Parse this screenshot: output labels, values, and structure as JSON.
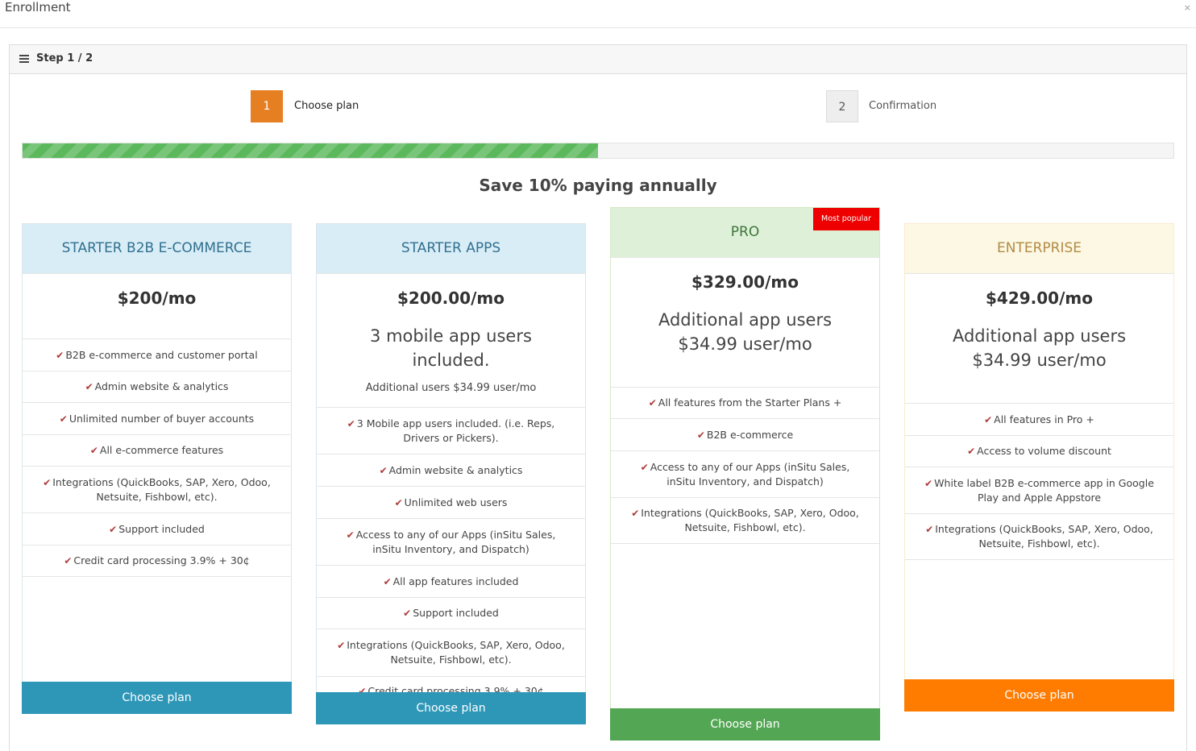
{
  "window": {
    "title": "Enrollment",
    "close": "×"
  },
  "panel": {
    "step_label": "Step 1 / 2"
  },
  "steps": [
    {
      "number": "1",
      "label": "Choose plan"
    },
    {
      "number": "2",
      "label": "Confirmation"
    }
  ],
  "progress": {
    "fraction": 0.5
  },
  "headline": "Save 10% paying annually",
  "colors": {
    "accent_orange": "#e67e22",
    "blue_button": "#2e97b8",
    "green_button": "#53a653",
    "orange_button": "#ff7c00",
    "badge_red": "#ee0000"
  },
  "plans": [
    {
      "name": "STARTER B2B E-COMMERCE",
      "price": "$200/mo",
      "features": [
        "B2B e-commerce and customer portal",
        "Admin website & analytics",
        "Unlimited number of buyer accounts",
        "All e-commerce features",
        "Integrations (QuickBooks, SAP, Xero, Odoo, Netsuite, Fishbowl, etc).",
        "Support included",
        "Credit card processing 3.9% + 30¢"
      ],
      "button": "Choose plan"
    },
    {
      "name": "STARTER APPS",
      "price": "$200.00/mo",
      "subtitle": "3 mobile app users included.",
      "note": "Additional users $34.99 user/mo",
      "features": [
        "3 Mobile app users included. (i.e. Reps, Drivers or Pickers).",
        "Admin website & analytics",
        "Unlimited web users",
        "Access to any of our Apps (inSitu Sales, inSitu Inventory, and Dispatch)",
        "All app features included",
        "Support included",
        "Integrations (QuickBooks, SAP, Xero, Odoo, Netsuite, Fishbowl, etc).",
        "Credit card processing 3.9% + 30¢"
      ],
      "button": "Choose plan"
    },
    {
      "name": "PRO",
      "badge": "Most popular",
      "price": "$329.00/mo",
      "subtitle": "Additional app users $34.99 user/mo",
      "features": [
        "All features from the Starter Plans +",
        "B2B e-commerce",
        "Access to any of our Apps (inSitu Sales, inSitu Inventory, and Dispatch)",
        "Integrations (QuickBooks, SAP, Xero, Odoo, Netsuite, Fishbowl, etc)."
      ],
      "button": "Choose plan"
    },
    {
      "name": "ENTERPRISE",
      "price": "$429.00/mo",
      "subtitle": "Additional app users $34.99 user/mo",
      "features": [
        "All features in Pro +",
        "Access to volume discount",
        "White label B2B e-commerce app in Google Play and Apple Appstore",
        "Integrations (QuickBooks, SAP, Xero, Odoo, Netsuite, Fishbowl, etc)."
      ],
      "button": "Choose plan"
    }
  ]
}
